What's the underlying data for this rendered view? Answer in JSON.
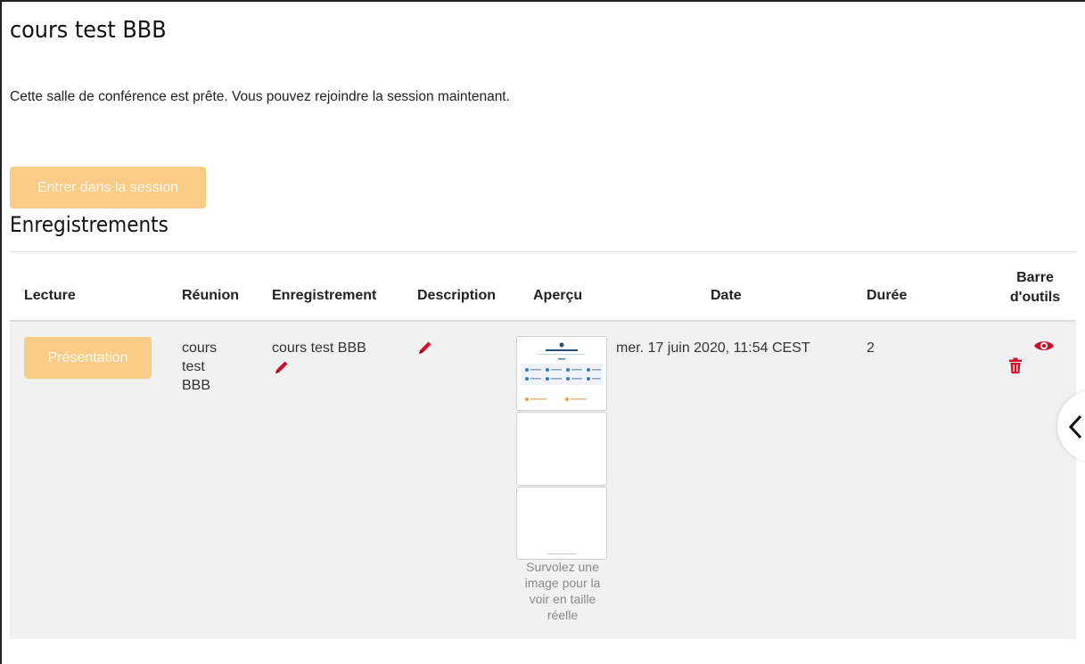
{
  "page": {
    "title": "cours test BBB",
    "status_message": "Cette salle de conférence est prête. Vous pouvez rejoindre la session maintenant.",
    "join_button_label": "Entrer dans la session"
  },
  "recordings": {
    "section_title": "Enregistrements",
    "columns": {
      "playback": "Lecture",
      "meeting": "Réunion",
      "recording": "Enregistrement",
      "description": "Description",
      "preview": "Aperçu",
      "date": "Date",
      "duration": "Durée",
      "toolbar_line1": "Barre",
      "toolbar_line2": "d'outils"
    },
    "rows": [
      {
        "playback_label": "Présentation",
        "meeting_line1": "cours",
        "meeting_line2": "test",
        "meeting_line3": "BBB",
        "recording_name": "cours test BBB",
        "date": "mer. 17 juin 2020, 11:54 CEST",
        "duration": "2",
        "preview_hint_line1": "Survolez une",
        "preview_hint_line2": "image pour la",
        "preview_hint_line3": "voir en taille",
        "preview_hint_line4": "réelle"
      }
    ]
  },
  "colors": {
    "button_bg": "#fbcc87",
    "icon_red": "#d0112b",
    "row_bg": "#f1f1f1"
  },
  "icons": [
    "pencil-icon",
    "eye-icon",
    "trash-icon",
    "chevron-left-icon"
  ]
}
